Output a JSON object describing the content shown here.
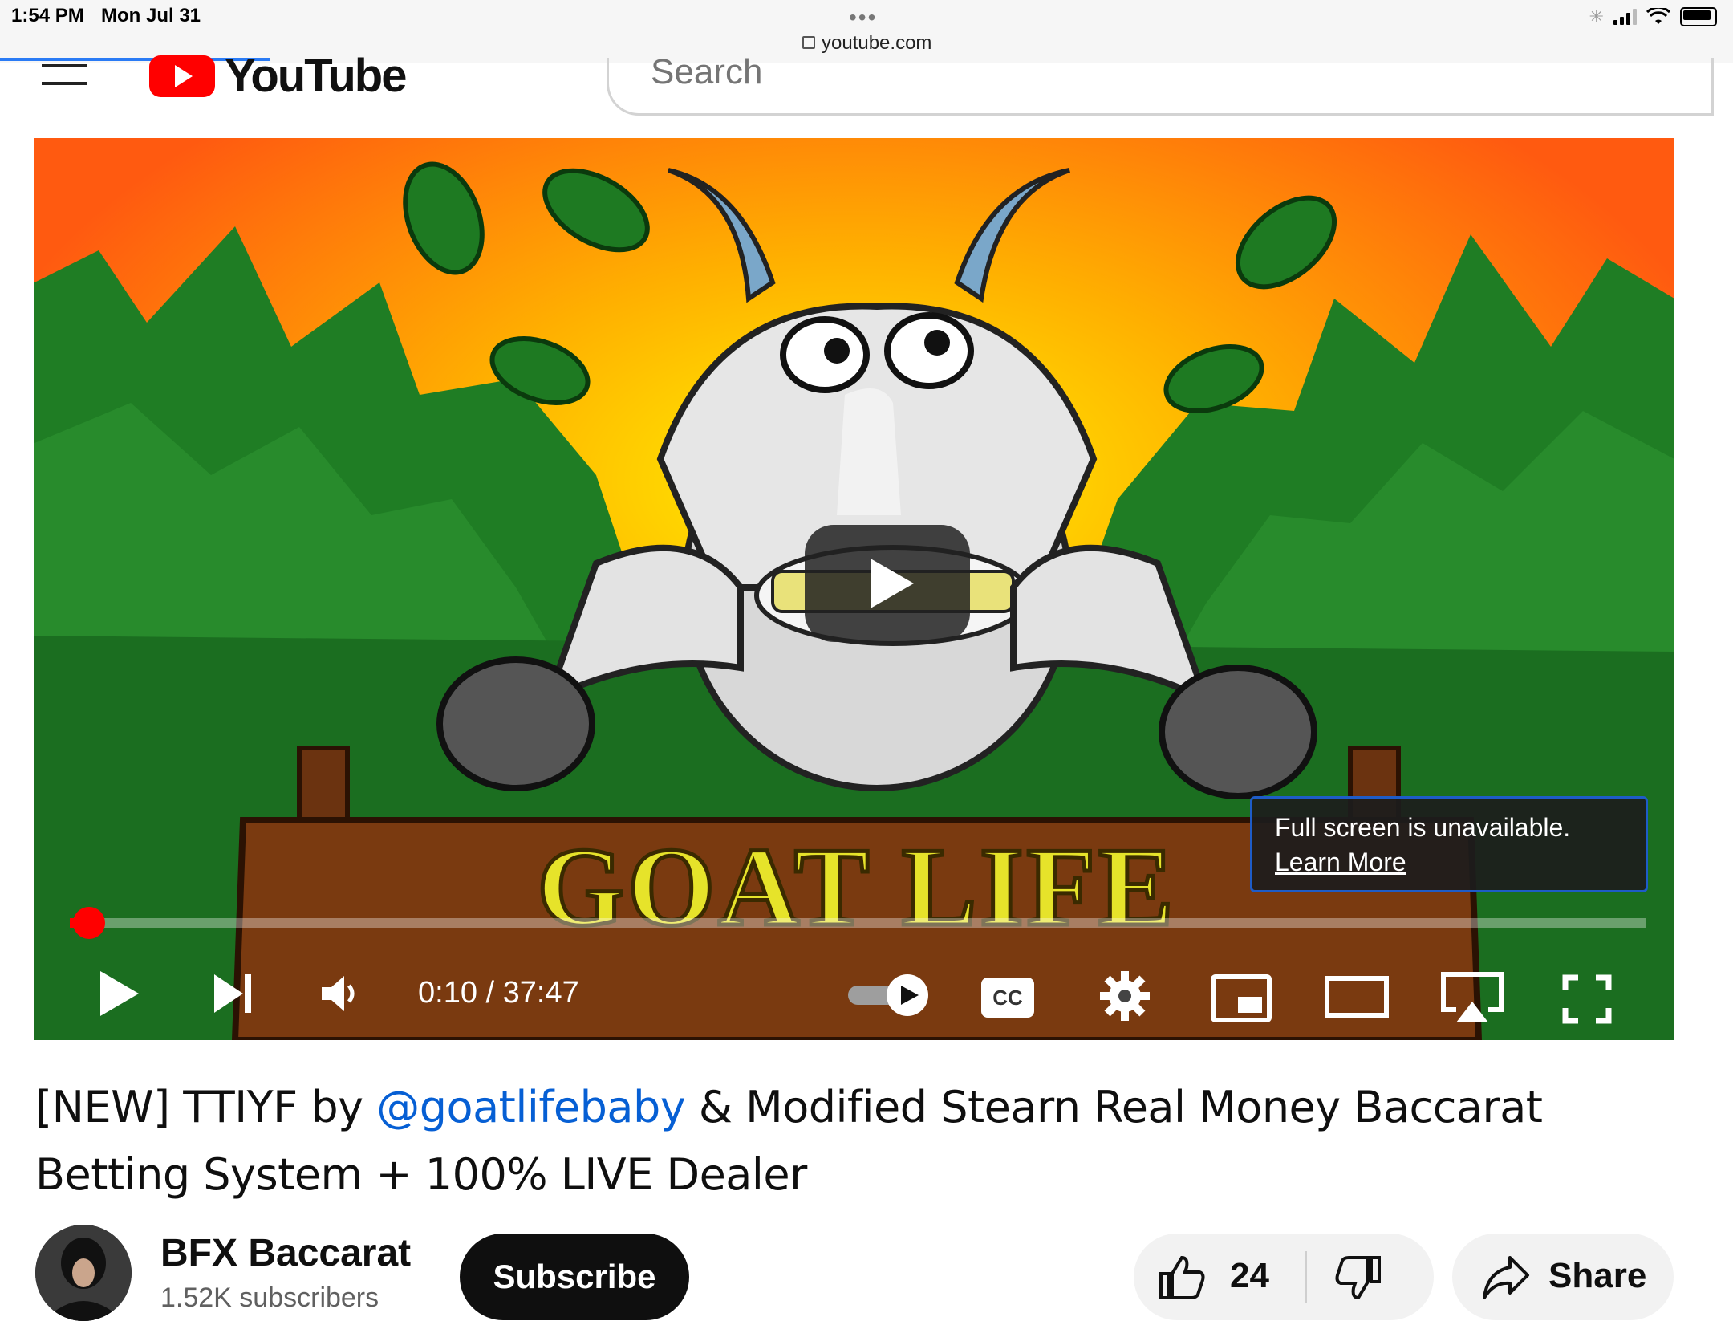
{
  "status_bar": {
    "time": "1:54 PM",
    "date": "Mon Jul 31",
    "url": "youtube.com"
  },
  "header": {
    "logo_text": "YouTube",
    "search_placeholder": "Search"
  },
  "player": {
    "thumbnail_text": "GOAT LIFE",
    "toast_message": "Full screen is unavailable.",
    "toast_link": "Learn More",
    "time_display": "0:10 / 37:47",
    "progress_fraction": 0.004,
    "autoplay": "on",
    "controls": [
      "play-icon",
      "next-icon",
      "volume-icon",
      "autoplay-toggle",
      "captions-icon",
      "settings-icon",
      "miniplayer-icon",
      "theater-icon",
      "airplay-icon",
      "fullscreen-icon"
    ]
  },
  "video": {
    "title_prefix": "[NEW] TTIYF by ",
    "title_mention": "@goatlifebaby",
    "title_suffix": " & Modified Stearn Real Money Baccarat Betting System + 100% LIVE Dealer"
  },
  "channel": {
    "name": "BFX Baccarat",
    "subscribers": "1.52K subscribers",
    "subscribe_label": "Subscribe"
  },
  "actions": {
    "like_count": "24",
    "share_label": "Share"
  },
  "colors": {
    "brand_red": "#ff0000",
    "link_blue": "#065fd4",
    "toast_border": "#1e5cc8"
  }
}
